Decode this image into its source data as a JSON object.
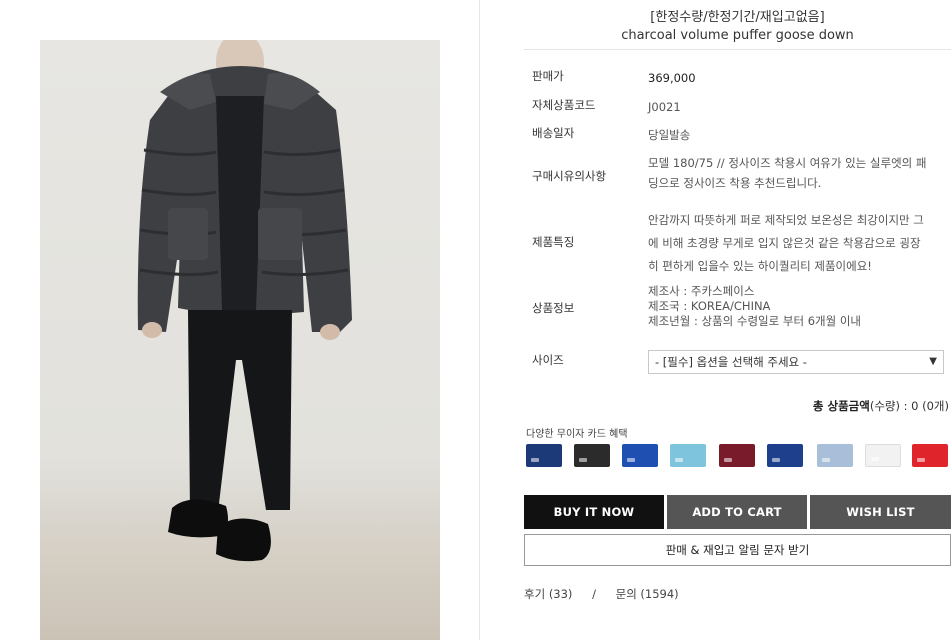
{
  "product": {
    "title_kr": "[한정수량/한정기간/재입고없음]",
    "title_en": "charcoal volume puffer goose down"
  },
  "info": {
    "price_label": "판매가",
    "price_value": "369,000",
    "code_label": "자체상품코드",
    "code_value": "J0021",
    "ship_label": "배송일자",
    "ship_value": "당일발송",
    "notice_label": "구매시유의사항",
    "notice_line1": "모델 180/75 // 정사이즈 착용시 여유가 있는 실루엣의 패",
    "notice_line2": "딩으로 정사이즈 착용 추천드립니다.",
    "feature_label": "제품특징",
    "feature_line1": "안감까지 따뜻하게 퍼로 제작되었 보온성은 최강이지만 그",
    "feature_line2": "에 비해 초경량 무게로 입지 않은것 같은 착용감으로 굉장",
    "feature_line3": "히 편하게 입을수 있는 하이퀄리티 제품이에요!",
    "detail_label": "상품정보",
    "detail_line1": "제조사 : 주카스페이스",
    "detail_line2": "제조국 : KOREA/CHINA",
    "detail_line3": "제조년월 : 상품의 수령일로 부터 6개월 이내",
    "size_label": "사이즈",
    "size_selected": "- [필수] 옵션을 선택해 주세요 -"
  },
  "total": {
    "label": "총 상품금액",
    "qty_label": "(수량) : 0 (0개)"
  },
  "cards": {
    "title": "다양한 무이자 카드 혜택",
    "colors": [
      "#1d3a78",
      "#2b2b2b",
      "#1f4fb0",
      "#7ec4dc",
      "#7a1b2c",
      "#1d3f8c",
      "#a9bed8",
      "#f2f2f2",
      "#e0242b"
    ]
  },
  "buttons": {
    "buy": "BUY IT NOW",
    "cart": "ADD TO CART",
    "wish": "WISH LIST",
    "alert": "판매 & 재입고 알림 문자 받기"
  },
  "reviews": {
    "review_label": "후기 (33)",
    "separator": "/",
    "qna_label": "문의 (1594)"
  }
}
